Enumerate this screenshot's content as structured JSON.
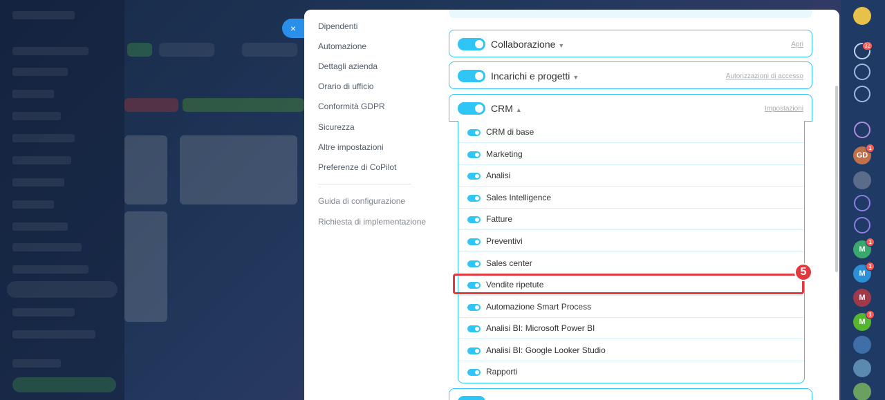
{
  "close_label": "×",
  "menu": {
    "items": [
      "Dipendenti",
      "Automazione",
      "Dettagli azienda",
      "Orario di ufficio",
      "Conformità GDPR",
      "Sicurezza",
      "Altre impostazioni",
      "Preferenze di CoPilot"
    ],
    "secondary": [
      "Guida di configurazione",
      "Richiesta di implementazione"
    ]
  },
  "cards": [
    {
      "title": "Collaborazione",
      "action": "Apri",
      "expanded": false
    },
    {
      "title": "Incarichi e progetti",
      "action": "Autorizzazioni di accesso",
      "expanded": false
    },
    {
      "title": "CRM",
      "action": "Impostazioni",
      "expanded": true
    }
  ],
  "crm_items": [
    "CRM di base",
    "Marketing",
    "Analisi",
    "Sales Intelligence",
    "Fatture",
    "Preventivi",
    "Sales center",
    "Vendite ripetute",
    "Automazione Smart Process",
    "Analisi BI: Microsoft Power BI",
    "Analisi BI: Google Looker Studio",
    "Rapporti"
  ],
  "highlighted_item": "Vendite ripetute",
  "step_number": "5",
  "rail": {
    "notification_count": "32",
    "avatars": [
      {
        "initials": "GD",
        "color": "#c0704a",
        "badge": "1"
      },
      {
        "initials": "M",
        "color": "#3aa76d",
        "badge": "1"
      },
      {
        "initials": "M",
        "color": "#2d8fd5",
        "badge": "1"
      },
      {
        "initials": "M",
        "color": "#a03a4a",
        "badge": ""
      },
      {
        "initials": "M",
        "color": "#55b530",
        "badge": "1"
      }
    ]
  },
  "colors": {
    "accent": "#2fc6f6",
    "highlight": "#e0393e",
    "close_button": "#2a8fe8"
  }
}
